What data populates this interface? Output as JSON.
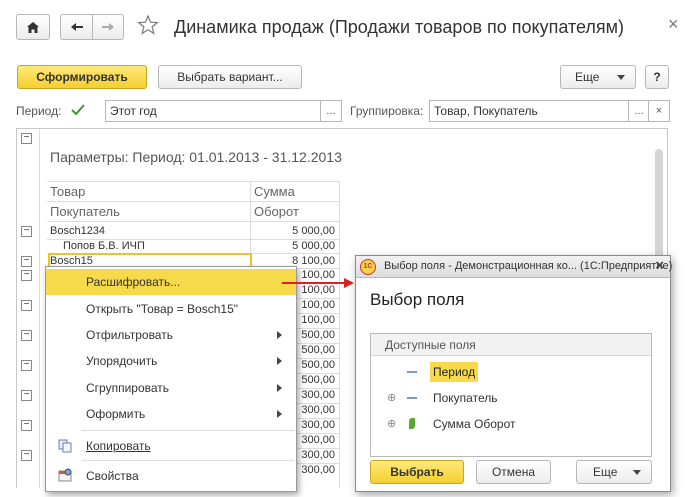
{
  "toolbar": {
    "home_icon": "home-icon",
    "back_icon": "arrow-left-icon",
    "forward_icon": "arrow-right-icon",
    "star_icon": "star-icon",
    "title": "Динамика продаж (Продажи товаров по покупателям)",
    "close": "×"
  },
  "actions": {
    "generate": "Сформировать",
    "choose_variant": "Выбрать вариант...",
    "more": "Еще",
    "help": "?"
  },
  "filters": {
    "period_label": "Период:",
    "period_value": "Этот год",
    "dots": "...",
    "grouping_label": "Группировка:",
    "grouping_value": "Товар, Покупатель",
    "clear": "×"
  },
  "report": {
    "params": "Параметры:   Период: 01.01.2013 - 31.12.2013",
    "col_product": "Товар",
    "col_customer": "Покупатель",
    "col_sum": "Сумма",
    "col_turnover": "Оборот",
    "rows": [
      {
        "name": "Bosch1234",
        "value": "5 000,00"
      },
      {
        "name": "Попов Б.В. ИЧП",
        "value": "5 000,00"
      },
      {
        "name": "Bosch15",
        "value": "8 100,00"
      }
    ],
    "hidden_values": [
      "100,00",
      "100,00",
      "100,00",
      "100,00",
      "500,00",
      "500,00",
      "500,00",
      "500,00",
      "300,00",
      "300,00",
      "300,00",
      "300,00",
      "300,00",
      "300,00"
    ]
  },
  "context_menu": {
    "items": [
      {
        "label": "Расшифровать..."
      },
      {
        "label": "Открыть \"Товар = Bosch15\""
      },
      {
        "label": "Отфильтровать"
      },
      {
        "label": "Упорядочить"
      },
      {
        "label": "Сгруппировать"
      },
      {
        "label": "Оформить"
      },
      {
        "label": "Копировать"
      },
      {
        "label": "Свойства"
      }
    ]
  },
  "dialog": {
    "window_title": "Выбор поля - Демонстрационная ко... (1С:Предприятие)",
    "close": "×",
    "heading": "Выбор поля",
    "fields_header": "Доступные поля",
    "fields": [
      {
        "label": "Период"
      },
      {
        "label": "Покупатель"
      },
      {
        "label": "Сумма Оборот"
      }
    ],
    "choose": "Выбрать",
    "cancel": "Отмена",
    "more": "Еще"
  },
  "colors": {
    "accent_yellow": "#f7d94c",
    "arrow_red": "#e02020",
    "check_green": "#3a9a2a"
  }
}
